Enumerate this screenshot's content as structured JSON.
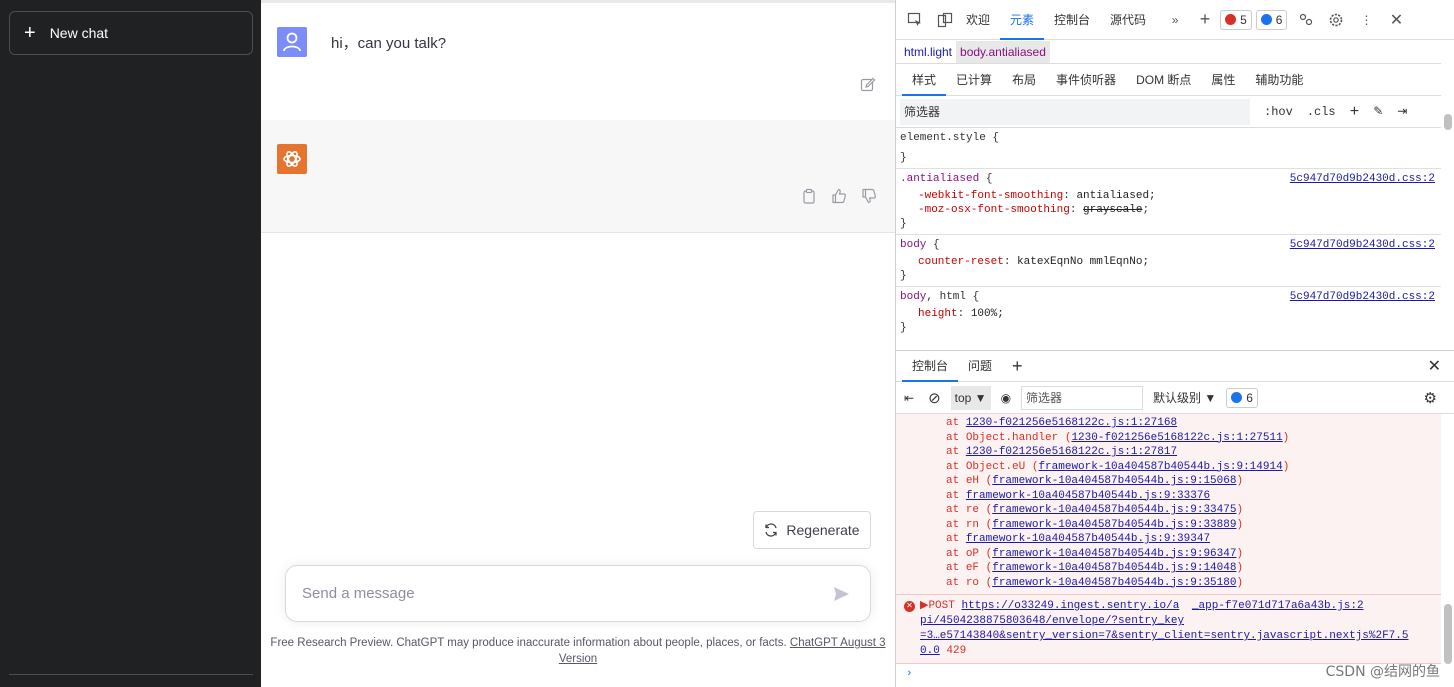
{
  "sidebar": {
    "new_chat_label": "New chat"
  },
  "chat": {
    "user_message": "hi，can you talk?",
    "regenerate_label": "Regenerate",
    "input_placeholder": "Send a message",
    "footer_text": "Free Research Preview. ChatGPT may produce inaccurate information about people, places, or facts. ",
    "footer_link": "ChatGPT August 3 Version",
    "user_avatar_color": "#7c8cf8",
    "bot_avatar_color": "#e4742f"
  },
  "devtools": {
    "tabs": [
      "欢迎",
      "元素",
      "控制台",
      "源代码"
    ],
    "active_tab": "元素",
    "error_count": "5",
    "message_count": "6",
    "breadcrumbs": [
      "html.light",
      "body.antialiased"
    ],
    "sub_tabs": [
      "样式",
      "已计算",
      "布局",
      "事件侦听器",
      "DOM 断点",
      "属性",
      "辅助功能"
    ],
    "filter_placeholder": "筛选器",
    "hov_label": ":hov",
    "cls_label": ".cls",
    "styles": {
      "element_style": "element.style {",
      "close_brace": "}",
      "rule1_selector": ".antialiased",
      "rule1_src": "5c947d70d9b2430d.css:2",
      "rule1_p1_name": "-webkit-font-smoothing",
      "rule1_p1_val": "antialiased;",
      "rule1_p2_name": "-moz-osx-font-smoothing",
      "rule1_p2_val": "grayscale",
      "rule2_selector": "body",
      "rule2_src": "5c947d70d9b2430d.css:2",
      "rule2_p1_name": "counter-reset",
      "rule2_p1_val": "katexEqnNo mmlEqnNo;",
      "rule3_selector": "body",
      "rule3_selector_plain": "html",
      "rule3_src": "5c947d70d9b2430d.css:2",
      "rule3_p1_name": "height",
      "rule3_p1_val": "100%;"
    },
    "drawer_tabs": [
      "控制台",
      "问题"
    ],
    "context": "top",
    "console_filter_placeholder": "筛选器",
    "level_label": "默认级别",
    "console_msg_count": "6",
    "stack": [
      {
        "pre": "at ",
        "fn": "",
        "link": "1230-f021256e5168122c.js:1:27168"
      },
      {
        "pre": "at ",
        "fn": "Object.handler (",
        "link": "1230-f021256e5168122c.js:1:27511",
        "post": ")"
      },
      {
        "pre": "at ",
        "fn": "",
        "link": "1230-f021256e5168122c.js:1:27817"
      },
      {
        "pre": "at ",
        "fn": "Object.eU (",
        "link": "framework-10a404587b40544b.js:9:14914",
        "post": ")"
      },
      {
        "pre": "at ",
        "fn": "eH (",
        "link": "framework-10a404587b40544b.js:9:15068",
        "post": ")"
      },
      {
        "pre": "at ",
        "fn": "",
        "link": "framework-10a404587b40544b.js:9:33376"
      },
      {
        "pre": "at ",
        "fn": "re (",
        "link": "framework-10a404587b40544b.js:9:33475",
        "post": ")"
      },
      {
        "pre": "at ",
        "fn": "rn (",
        "link": "framework-10a404587b40544b.js:9:33889",
        "post": ")"
      },
      {
        "pre": "at ",
        "fn": "",
        "link": "framework-10a404587b40544b.js:9:39347"
      },
      {
        "pre": "at ",
        "fn": "oP (",
        "link": "framework-10a404587b40544b.js:9:96347",
        "post": ")"
      },
      {
        "pre": "at ",
        "fn": "eF (",
        "link": "framework-10a404587b40544b.js:9:14048",
        "post": ")"
      },
      {
        "pre": "at ",
        "fn": "ro (",
        "link": "framework-10a404587b40544b.js:9:35180",
        "post": ")"
      }
    ],
    "post_error": {
      "method": "▶POST ",
      "url_line1": "https://o33249.ingest.sentry.io/a",
      "source": "_app-f7e071d717a6a43b.js:2",
      "url_line2": "pi/4504238875803648/envelope/?sentry_key",
      "url_line3": "=3…e57143840&sentry_version=7&sentry_client=sentry.javascript.nextjs%2F7.5",
      "url_line4": "0.0",
      "status": " 429"
    }
  },
  "watermark": "CSDN @结网的鱼"
}
